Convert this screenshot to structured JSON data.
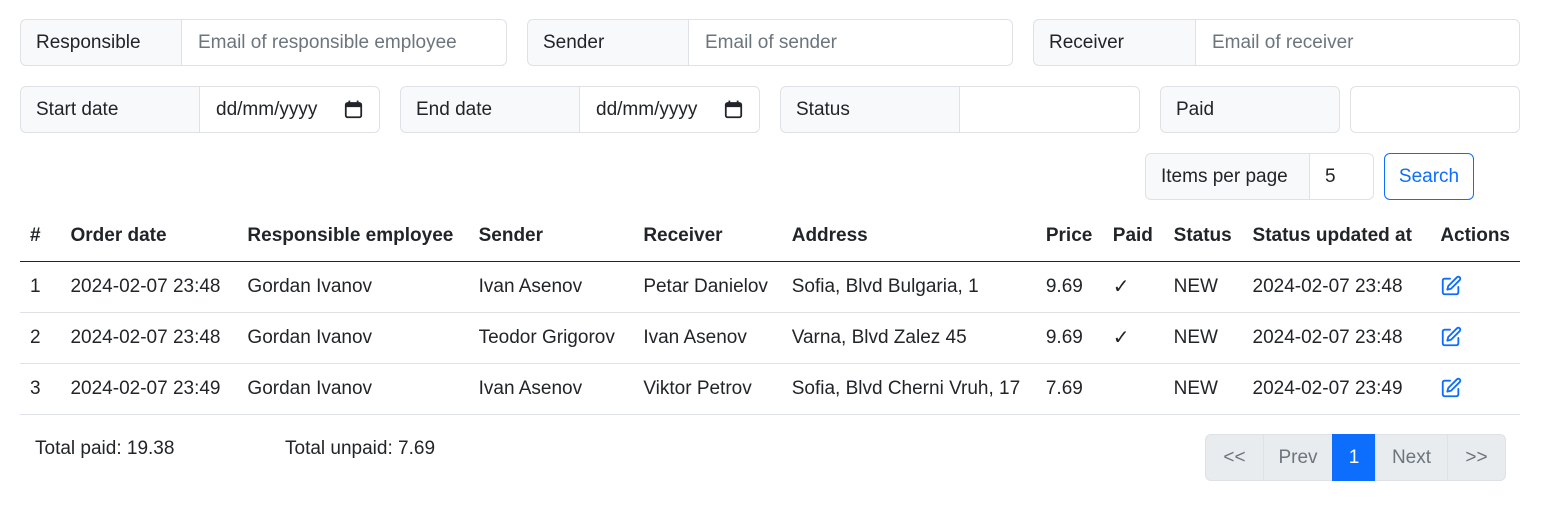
{
  "filters": {
    "responsible": {
      "label": "Responsible",
      "placeholder": "Email of responsible employee"
    },
    "sender": {
      "label": "Sender",
      "placeholder": "Email of sender"
    },
    "receiver": {
      "label": "Receiver",
      "placeholder": "Email of receiver"
    },
    "start_date": {
      "label": "Start date",
      "value": "dd/mm/yyyy"
    },
    "end_date": {
      "label": "End date",
      "value": "dd/mm/yyyy"
    },
    "status": {
      "label": "Status",
      "value": ""
    },
    "paid": {
      "label": "Paid",
      "value": ""
    },
    "items_per_page": {
      "label": "Items per page",
      "value": "5"
    },
    "search_label": "Search"
  },
  "table": {
    "headers": [
      "#",
      "Order date",
      "Responsible employee",
      "Sender",
      "Receiver",
      "Address",
      "Price",
      "Paid",
      "Status",
      "Status updated at",
      "Actions"
    ],
    "rows": [
      {
        "num": "1",
        "order_date": "2024-02-07 23:48",
        "responsible": "Gordan Ivanov",
        "sender": "Ivan Asenov",
        "receiver": "Petar Danielov",
        "address": "Sofia, Blvd Bulgaria, 1",
        "price": "9.69",
        "paid": "✓",
        "status": "NEW",
        "updated": "2024-02-07 23:48"
      },
      {
        "num": "2",
        "order_date": "2024-02-07 23:48",
        "responsible": "Gordan Ivanov",
        "sender": "Teodor Grigorov",
        "receiver": "Ivan Asenov",
        "address": "Varna, Blvd Zalez 45",
        "price": "9.69",
        "paid": "✓",
        "status": "NEW",
        "updated": "2024-02-07 23:48"
      },
      {
        "num": "3",
        "order_date": "2024-02-07 23:49",
        "responsible": "Gordan Ivanov",
        "sender": "Ivan Asenov",
        "receiver": "Viktor Petrov",
        "address": "Sofia, Blvd Cherni Vruh, 17",
        "price": "7.69",
        "paid": "",
        "status": "NEW",
        "updated": "2024-02-07 23:49"
      }
    ]
  },
  "totals": {
    "paid": "Total paid: 19.38",
    "unpaid": "Total unpaid: 7.69"
  },
  "pagination": {
    "first": "<<",
    "prev": "Prev",
    "current": "1",
    "next": "Next",
    "last": ">>"
  },
  "colors": {
    "primary": "#0d6efd",
    "border": "#dee2e6",
    "label_bg": "#f8f9fa"
  }
}
